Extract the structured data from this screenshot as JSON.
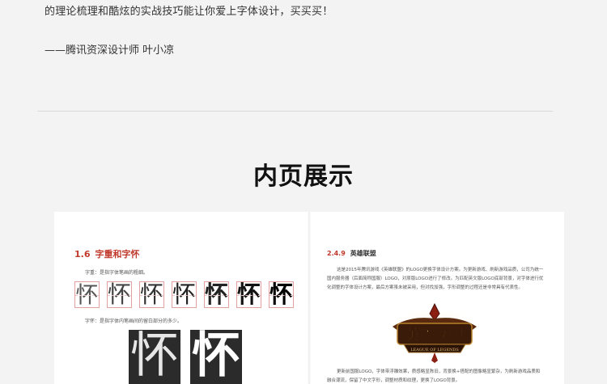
{
  "intro": {
    "line": "的理论梳理和酷炫的实战技巧能让你爱上字体设计，买买买！",
    "signature": "——腾讯资深设计师 叶小凉"
  },
  "section": {
    "title": "内页展示"
  },
  "left_page": {
    "heading_num": "1.6",
    "heading_text": "字重和字怀",
    "text1": "字重：是指字体笔画的粗细。",
    "weight_chars": [
      "怀",
      "怀",
      "怀",
      "怀",
      "怀",
      "怀",
      "怀"
    ],
    "text2": "字怀：是指字体内笔画间的留白部分的多少。",
    "big_thin": "怀",
    "big_bold": "怀"
  },
  "right_page": {
    "heading_num": "2.4.9",
    "heading_text": "英雄联盟",
    "para1": "这是2015年腾讯游戏《英雄联盟》的LOGO更换字体设计方案。为更新游戏、刷新游戏品质，公司为统一国内服务器（后面简称国服）LOGO，对原版LOGO进行了修改。为匹配英文版LOGO底部背景，对字体进行优化调整的字体设计方案，最后方案虽未被采用，但对找加强，字形调整的过程还是非常具有代表性。",
    "logo_text": "英雄联盟",
    "logo_sub": "LEAGUE OF LEGENDS",
    "para2": "更新前国服LOGO，字体带浮雕效果，质感略显陈旧，背景换+搭配的图像略显繁杂，为刷新游戏品质和融合潮流，保留了中文字形，调整材质和纹理，更换了LOGO背景。"
  }
}
